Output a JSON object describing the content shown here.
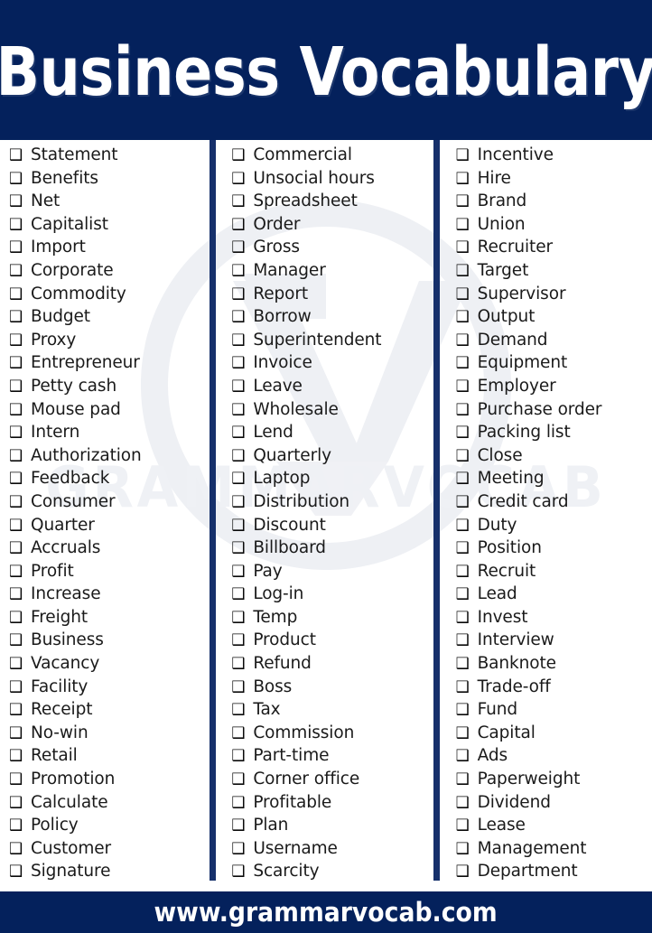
{
  "header": {
    "title": "Business Vocabulary",
    "bg_color": "#04215c",
    "text_color": "#ffffff"
  },
  "watermark": {
    "text": "GRAMMARVOCAB",
    "color": "#eff1f5",
    "mark": "v-logo-mark"
  },
  "list": {
    "checkbox_glyph": "❑",
    "divider_color": "#16306b",
    "columns": [
      {
        "id": "column-1",
        "items": [
          "Statement",
          "Benefits",
          "Net",
          "Capitalist",
          "Import",
          "Corporate",
          "Commodity",
          "Budget",
          "Proxy",
          "Entrepreneur",
          "Petty cash",
          "Mouse pad",
          "Intern",
          "Authorization",
          "Feedback",
          "Consumer",
          "Quarter",
          "Accruals",
          "Profit",
          "Increase",
          "Freight",
          "Business",
          "Vacancy",
          "Facility",
          "Receipt",
          "No-win",
          "Retail",
          "Promotion",
          "Calculate",
          "Policy",
          "Customer",
          "Signature"
        ]
      },
      {
        "id": "column-2",
        "items": [
          "Commercial",
          "Unsocial hours",
          "Spreadsheet",
          "Order",
          "Gross",
          "Manager",
          "Report",
          "Borrow",
          "Superintendent",
          "Invoice",
          "Leave",
          "Wholesale",
          "Lend",
          "Quarterly",
          "Laptop",
          "Distribution",
          "Discount",
          "Billboard",
          "Pay",
          "Log-in",
          "Temp",
          "Product",
          "Refund",
          "Boss",
          "Tax",
          "Commission",
          "Part-time",
          "Corner office",
          "Profitable",
          "Plan",
          "Username",
          "Scarcity"
        ]
      },
      {
        "id": "column-3",
        "items": [
          "Incentive",
          "Hire",
          "Brand",
          "Union",
          "Recruiter",
          "Target",
          "Supervisor",
          "Output",
          "Demand",
          "Equipment",
          "Employer",
          "Purchase order",
          "Packing list",
          "Close",
          "Meeting",
          "Credit card",
          "Duty",
          "Position",
          "Recruit",
          "Lead",
          "Invest",
          "Interview",
          "Banknote",
          "Trade-off",
          "Fund",
          "Capital",
          "Ads",
          "Paperweight",
          "Dividend",
          "Lease",
          "Management",
          "Department"
        ]
      }
    ]
  },
  "footer": {
    "url": "www.grammarvocab.com",
    "bg_color": "#04215c",
    "text_color": "#ffffff"
  }
}
